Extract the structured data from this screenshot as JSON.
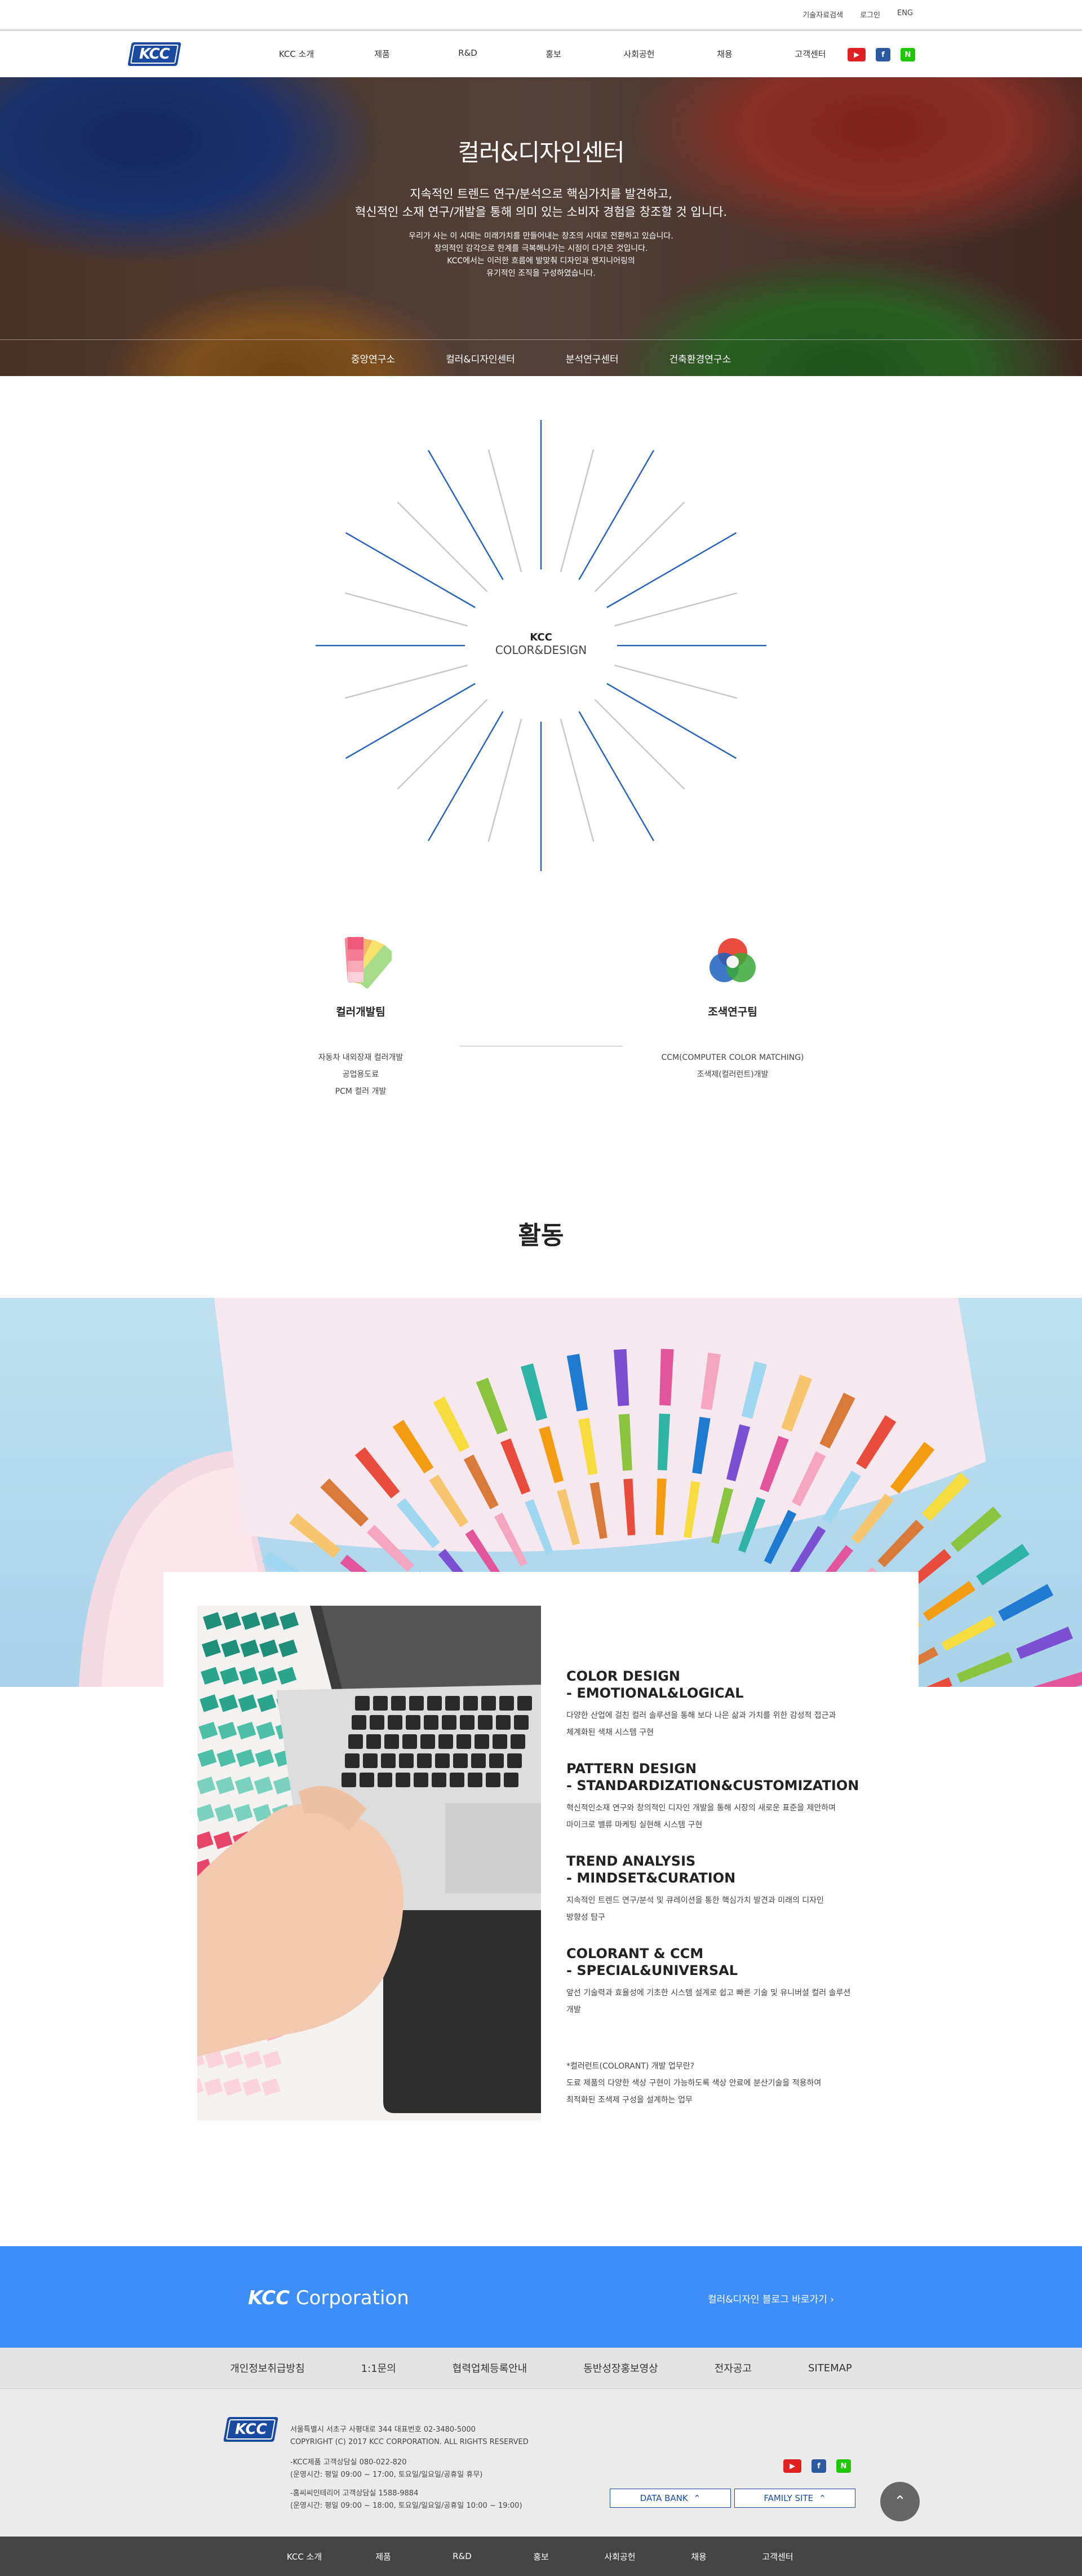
{
  "utility": {
    "links": [
      "기술자료검색",
      "로그인",
      "ENG"
    ]
  },
  "header": {
    "logo_text": "KCC",
    "nav": [
      "KCC 소개",
      "제품",
      "R&D",
      "홍보",
      "사회공헌",
      "채용",
      "고객센터"
    ],
    "sns_icons": [
      "youtube-icon",
      "facebook-icon",
      "naver-blog-icon"
    ]
  },
  "hero": {
    "title": "컬러&디자인센터",
    "lead_line1": "지속적인 트렌드 연구/분석으로 핵심가치를 발견하고,",
    "lead_line2": "혁신적인 소재 연구/개발을 통해 의미 있는 소비자 경험을 창조할 것 입니다.",
    "desc_line1": "우리가 사는 이 시대는 미래가치를 만들어내는 창조의 시대로 전환하고 있습니다.",
    "desc_line2": "창의적인 감각으로 한계를 극복해나가는 시점이 다가온 것입니다.",
    "desc_line3": "KCC에서는 이러한 흐름에 발맞춰 디자인과 엔지니어링의",
    "desc_line4": "유기적인 조직을 구성하였습니다.",
    "subnav": [
      "중앙연구소",
      "컬러&디자인센터",
      "분석연구센터",
      "건축환경연구소"
    ]
  },
  "burst": {
    "line1": "KCC",
    "line2": "COLOR&DESIGN"
  },
  "teams": [
    {
      "name": "컬러개발팀",
      "icon": "color-swatch-icon",
      "items": [
        "자동차 내외장재 컬러개발",
        "공업용도료",
        "PCM 컬러 개발"
      ]
    },
    {
      "name": "조색연구팀",
      "icon": "rgb-circles-icon",
      "items": [
        "CCM(COMPUTER COLOR MATCHING)",
        "조색제(컬러런트)개발"
      ]
    }
  ],
  "activity": {
    "title": "활동",
    "points": [
      {
        "title1": "COLOR DESIGN",
        "title2": "- EMOTIONAL&LOGICAL",
        "desc1": "다양한 산업에 걸친 컬러 솔루션을 통해 보다 나은 삶과 가치를 위한 감성적 접근과",
        "desc2": "체계화된 색채 시스템 구현"
      },
      {
        "title1": "PATTERN DESIGN",
        "title2": "- STANDARDIZATION&CUSTOMIZATION",
        "desc1": "혁신적인소재 연구와 창의적인 디자인 개발을 통해 시장의 새로운 표준을 제안하며",
        "desc2": "마이크로 밸류 마케팅 실현해 시스템 구현"
      },
      {
        "title1": "TREND ANALYSIS",
        "title2": "- MINDSET&CURATION",
        "desc1": "지속적인 트렌드 연구/분석 및 큐레이션을 통한 핵심가치 발견과 미래의 디자인",
        "desc2": "방향성 탐구"
      },
      {
        "title1": "COLORANT & CCM",
        "title2": "- SPECIAL&UNIVERSAL",
        "desc1": "앞선 기술력과 효율성에 기초한 시스템 설계로 쉽고 빠른 기술 및 유니버셜 컬러 솔루션",
        "desc2": "개발"
      }
    ],
    "note_line1": "*컬러런트(COLORANT) 개발 업무란?",
    "note_line2": "도료 제품의 다양한 색상 구현이 가능하도록 색상 안료에 분산기술을 적용하여",
    "note_line3": "최적화된 조색제 구성을 설계하는 업무"
  },
  "band": {
    "logo_bold": "KCC",
    "logo_rest": "Corporation",
    "link": "컬러&디자인 블로그 바로가기  ›"
  },
  "footer": {
    "links": [
      "개인정보취급방침",
      "1:1문의",
      "협력업체등록안내",
      "동반성장홍보영상",
      "전자공고",
      "SITEMAP"
    ],
    "logo_text": "KCC",
    "address": "서울특별시 서초구 사평대로 344    대표번호 02-3480-5000",
    "copyright": "COPYRIGHT (C) 2017 KCC CORPORATION. ALL RIGHTS RESERVED",
    "cs1_line1": "-KCC제품 고객상담실 080-022-820",
    "cs1_line2": "(운영시간: 평일 09:00 ~ 17:00, 토요일/일요일/공휴일 휴무)",
    "cs2_line1": "-홈씨씨인테리어 고객상담실 1588-9884",
    "cs2_line2": "(운영시간: 평일 09:00 ~ 18:00, 토요일/일요일/공휴일 10:00 ~ 19:00)",
    "databank": "DATA BANK",
    "familysite": "FAMILY SITE",
    "bottom_nav": [
      "KCC 소개",
      "제품",
      "R&D",
      "홍보",
      "사회공헌",
      "채용",
      "고객센터"
    ]
  },
  "colors": {
    "brand_blue": "#1a4ba0",
    "band_blue": "#3d8ef8",
    "footer_dark": "#444444"
  }
}
